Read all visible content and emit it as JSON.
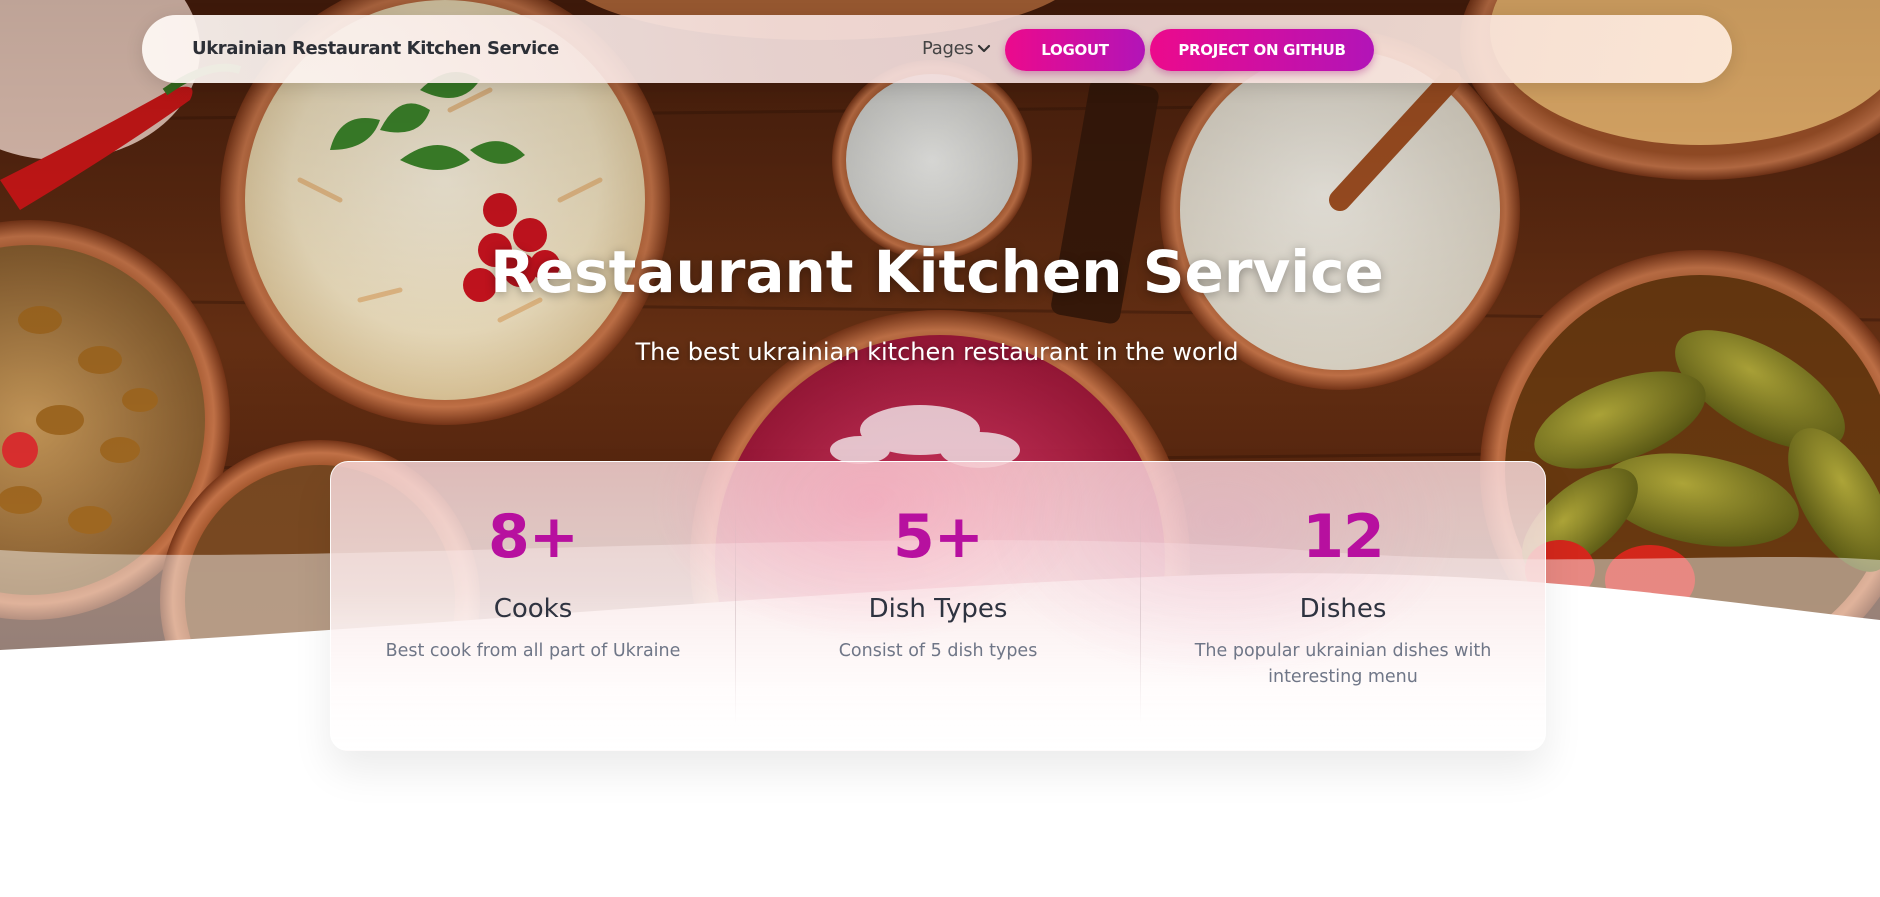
{
  "navbar": {
    "brand": "Ukrainian Restaurant Kitchen Service",
    "pages_label": "Pages",
    "logout_label": "LOGOUT",
    "github_label": "PROJECT ON GITHUB"
  },
  "hero": {
    "title": "Restaurant Kitchen Service",
    "subtitle": "The best ukrainian kitchen restaurant in the world"
  },
  "stats": [
    {
      "value": "8+",
      "label": "Cooks",
      "description": "Best cook from all part of Ukraine"
    },
    {
      "value": "5+",
      "label": "Dish Types",
      "description": "Consist of 5 dish types"
    },
    {
      "value": "12",
      "label": "Dishes",
      "description": "The popular ukrainian dishes with interesting menu"
    }
  ],
  "colors": {
    "accent": "#b7109f",
    "button_gradient_start": "#ec0a8c",
    "button_gradient_end": "#b214b8",
    "table_wood": "#5a2a14"
  },
  "icons": {
    "pages_dropdown": "chevron-down-icon"
  }
}
